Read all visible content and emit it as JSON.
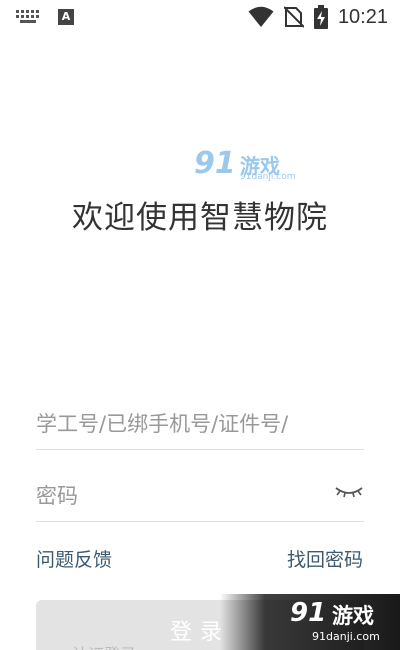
{
  "status_bar": {
    "time": "10:21",
    "icons": [
      "keyboard-icon",
      "a-notification-icon",
      "wifi-icon",
      "no-sim-icon",
      "battery-charging-icon"
    ],
    "a_icon_letter": "A"
  },
  "watermark_center": {
    "number": "91",
    "text": "游戏",
    "url": "91danji.com"
  },
  "title": "欢迎使用智慧物院",
  "form": {
    "account_placeholder": "学工号/已绑手机号/证件号/",
    "password_placeholder": "密码"
  },
  "links": {
    "feedback": "问题反馈",
    "recover": "找回密码"
  },
  "login_label": "登录",
  "login_sub_hint": "认证登录",
  "watermark_corner": {
    "number": "91",
    "text": "游戏",
    "url": "91danji.com"
  }
}
